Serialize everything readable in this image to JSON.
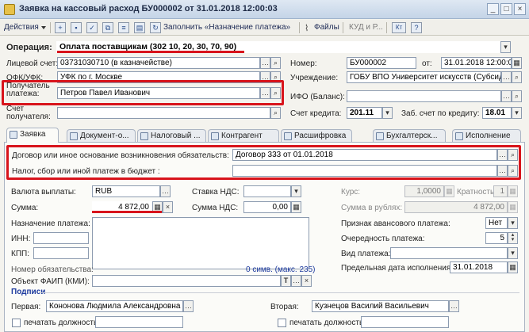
{
  "window": {
    "title": "Заявка на кассовый расход БУ000002 от 31.01.2018 12:00:03",
    "btn_min": "_",
    "btn_max": "□",
    "btn_close": "×"
  },
  "toolbar": {
    "actions": "Действия",
    "fill_purpose": "Заполнить «Назначение платежа»",
    "files": "Файлы",
    "kud": "КУД и Р...",
    "kt": "Кт"
  },
  "operation": {
    "label": "Операция:",
    "value": "Оплата поставщикам (302 10, 20, 30, 70, 90)"
  },
  "left": {
    "account_label": "Лицевой счет:",
    "account_value": "03731030710 (в казначействе)",
    "ofk_label": "ОФК/УФК:",
    "ofk_value": "УФК по г. Москве",
    "payee_label": "Получатель платежа:",
    "payee_value": "Петров Павел Иванович",
    "payee_acc_label": "Счет получателя:",
    "payee_acc_value": ""
  },
  "right": {
    "number_label": "Номер:",
    "number_value": "БУ000002",
    "date_label": "от:",
    "date_value": "31.01.2018 12:00:03",
    "institution_label": "Учреждение:",
    "institution_value": "ГОБУ ВПО Университет искусств (Субсидия...",
    "ifo_label": "ИФО (Баланс):",
    "ifo_value": "",
    "credit_label": "Счет кредита:",
    "credit_value": "201.11",
    "zab_label": "Заб. счет по кредиту:",
    "zab_value": "18.01"
  },
  "tabs": [
    "Заявка",
    "Документ-о...",
    "Налоговый ...",
    "Контрагент",
    "Расшифровка",
    "Бухгалтерск...",
    "Исполнение"
  ],
  "contract": {
    "label": "Договор или иное основание возникновения обязательств:",
    "value": "Договор 333 от 01.01.2018"
  },
  "tax": {
    "label": "Налог, сбор или иной платеж в бюджет :",
    "value": ""
  },
  "form": {
    "currency_label": "Валюта выплаты:",
    "currency_value": "RUB",
    "vat_rate_label": "Ставка НДС:",
    "vat_rate_value": "",
    "rate_label": "Курс:",
    "rate_value": "1,0000",
    "mult_label": "Кратность:",
    "mult_value": "1",
    "sum_label": "Сумма:",
    "sum_value": "4 872,00",
    "vat_sum_label": "Сумма НДС:",
    "vat_sum_value": "0,00",
    "rub_sum_label": "Сумма в рублях:",
    "rub_sum_value": "4 872,00",
    "purpose_label": "Назначение платежа:",
    "advance_label": "Признак авансового платежа:",
    "advance_value": "Нет",
    "inn_label": "ИНН:",
    "priority_label": "Очередность платежа:",
    "priority_value": "5",
    "kpp_label": "КПП:",
    "paytype_label": "Вид платежа:",
    "paytype_value": "",
    "obligation_label": "Номер обязательства:",
    "symbols": "0 симв. (макс. 235)",
    "deadline_label": "Предельная дата исполнения:",
    "deadline_value": "31.01.2018",
    "faip_label": "Объект ФАИП (КМИ):",
    "faip_value": "",
    "signatures": "Подписи",
    "first_label": "Первая:",
    "first_value": "Кононова Людмила Александровна",
    "second_label": "Вторая:",
    "second_value": "Кузнецов Василий Васильевич",
    "print_pos1": "печатать должность",
    "print_pos2": "печатать должность"
  }
}
